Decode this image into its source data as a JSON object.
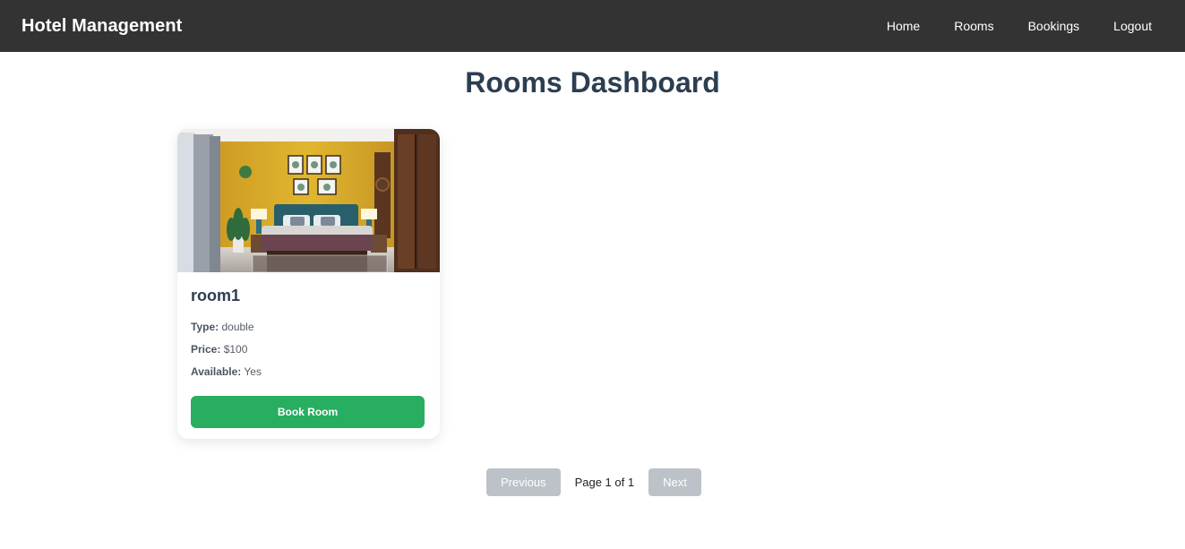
{
  "navbar": {
    "brand": "Hotel Management",
    "links": [
      "Home",
      "Rooms",
      "Bookings",
      "Logout"
    ]
  },
  "page": {
    "title": "Rooms Dashboard"
  },
  "rooms": [
    {
      "name": "room1",
      "type_label": "Type:",
      "type_value": "double",
      "price_label": "Price:",
      "price_value": "$100",
      "available_label": "Available:",
      "available_value": "Yes",
      "book_label": "Book Room"
    }
  ],
  "pagination": {
    "previous_label": "Previous",
    "info": "Page 1 of 1",
    "next_label": "Next"
  },
  "colors": {
    "navbar": "#333333",
    "title": "#2c3e50",
    "book_button": "#27ae60",
    "pagination_disabled": "#bcc2c8"
  }
}
